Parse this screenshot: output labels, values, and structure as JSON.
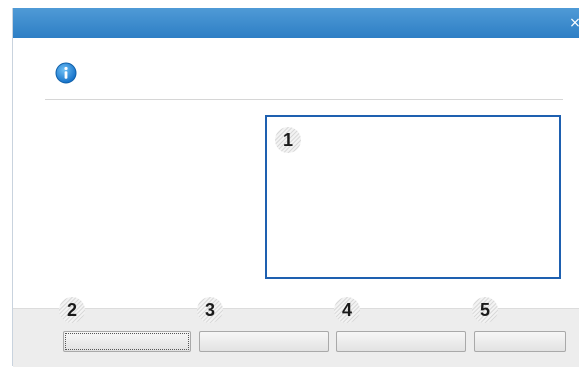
{
  "window": {
    "title": "",
    "close_glyph": "×",
    "icon": "info-icon",
    "accent_color": "#2e7fc5"
  },
  "markers": [
    "1",
    "2",
    "3",
    "4",
    "5"
  ],
  "buttons": [
    {
      "label": "",
      "focused": true
    },
    {
      "label": "",
      "focused": false
    },
    {
      "label": "",
      "focused": false
    },
    {
      "label": "",
      "focused": false
    }
  ]
}
